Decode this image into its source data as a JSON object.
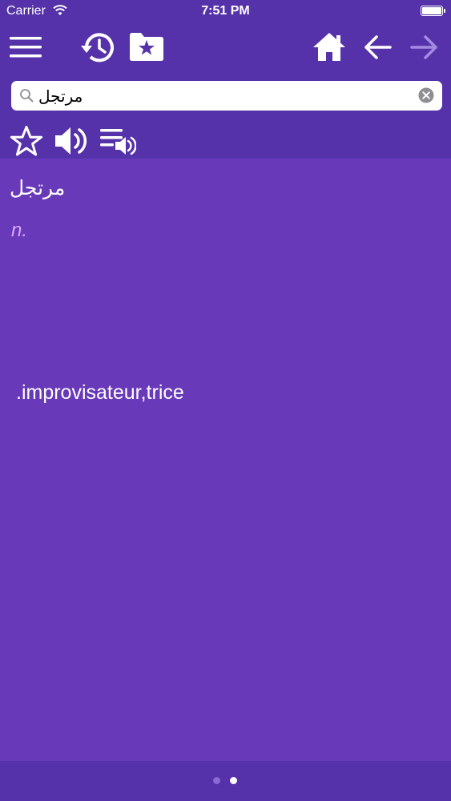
{
  "status": {
    "carrier": "Carrier",
    "time": "7:51 PM"
  },
  "toolbar": {
    "icons": [
      "menu-icon",
      "history-icon",
      "favorites-folder-icon",
      "home-icon",
      "back-arrow-icon",
      "forward-arrow-icon"
    ]
  },
  "search": {
    "value": "مرتجل",
    "placeholder": ""
  },
  "actions": {
    "icons": [
      "star-icon",
      "speaker-icon",
      "playlist-audio-icon"
    ]
  },
  "entry": {
    "headword": "مرتجل",
    "part_of_speech": "n.",
    "definition": ".improvisateur,trice"
  },
  "pager": {
    "pages": 2,
    "current": 2
  },
  "colors": {
    "bar": "#5532aa",
    "content": "#6839b9",
    "pos_text": "#d9a6ff",
    "forward_disabled": "#a58be0"
  }
}
